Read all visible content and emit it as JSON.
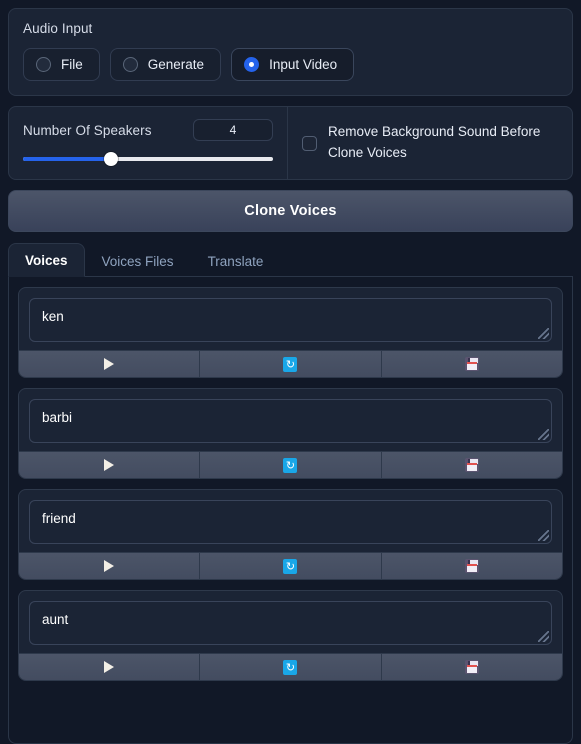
{
  "audio_input": {
    "label": "Audio Input",
    "options": [
      {
        "label": "File",
        "selected": false
      },
      {
        "label": "Generate",
        "selected": false
      },
      {
        "label": "Input Video",
        "selected": true
      }
    ]
  },
  "speakers": {
    "label": "Number Of Speakers",
    "value": "4",
    "slider_percent": 35,
    "checkbox": {
      "label": "Remove Background Sound Before Clone Voices",
      "checked": false
    }
  },
  "clone_button": {
    "label": "Clone Voices"
  },
  "tabs": [
    {
      "label": "Voices",
      "active": true
    },
    {
      "label": "Voices Files",
      "active": false
    },
    {
      "label": "Translate",
      "active": false
    }
  ],
  "voices": [
    {
      "name": "ken",
      "play": "play-icon",
      "refresh": "refresh-icon",
      "save": "save-icon"
    },
    {
      "name": "barbi",
      "play": "play-icon",
      "refresh": "refresh-icon",
      "save": "save-icon"
    },
    {
      "name": "friend",
      "play": "play-icon",
      "refresh": "refresh-icon",
      "save": "save-icon"
    },
    {
      "name": "aunt",
      "play": "play-icon",
      "refresh": "refresh-icon",
      "save": "save-icon"
    }
  ],
  "icons": {
    "refresh_glyph": "↻"
  },
  "colors": {
    "page_bg": "#111827",
    "panel_bg": "#1b2435",
    "accent": "#2563eb",
    "refresh_blue": "#19a7e8",
    "button_gradient_top": "#4c5569"
  }
}
